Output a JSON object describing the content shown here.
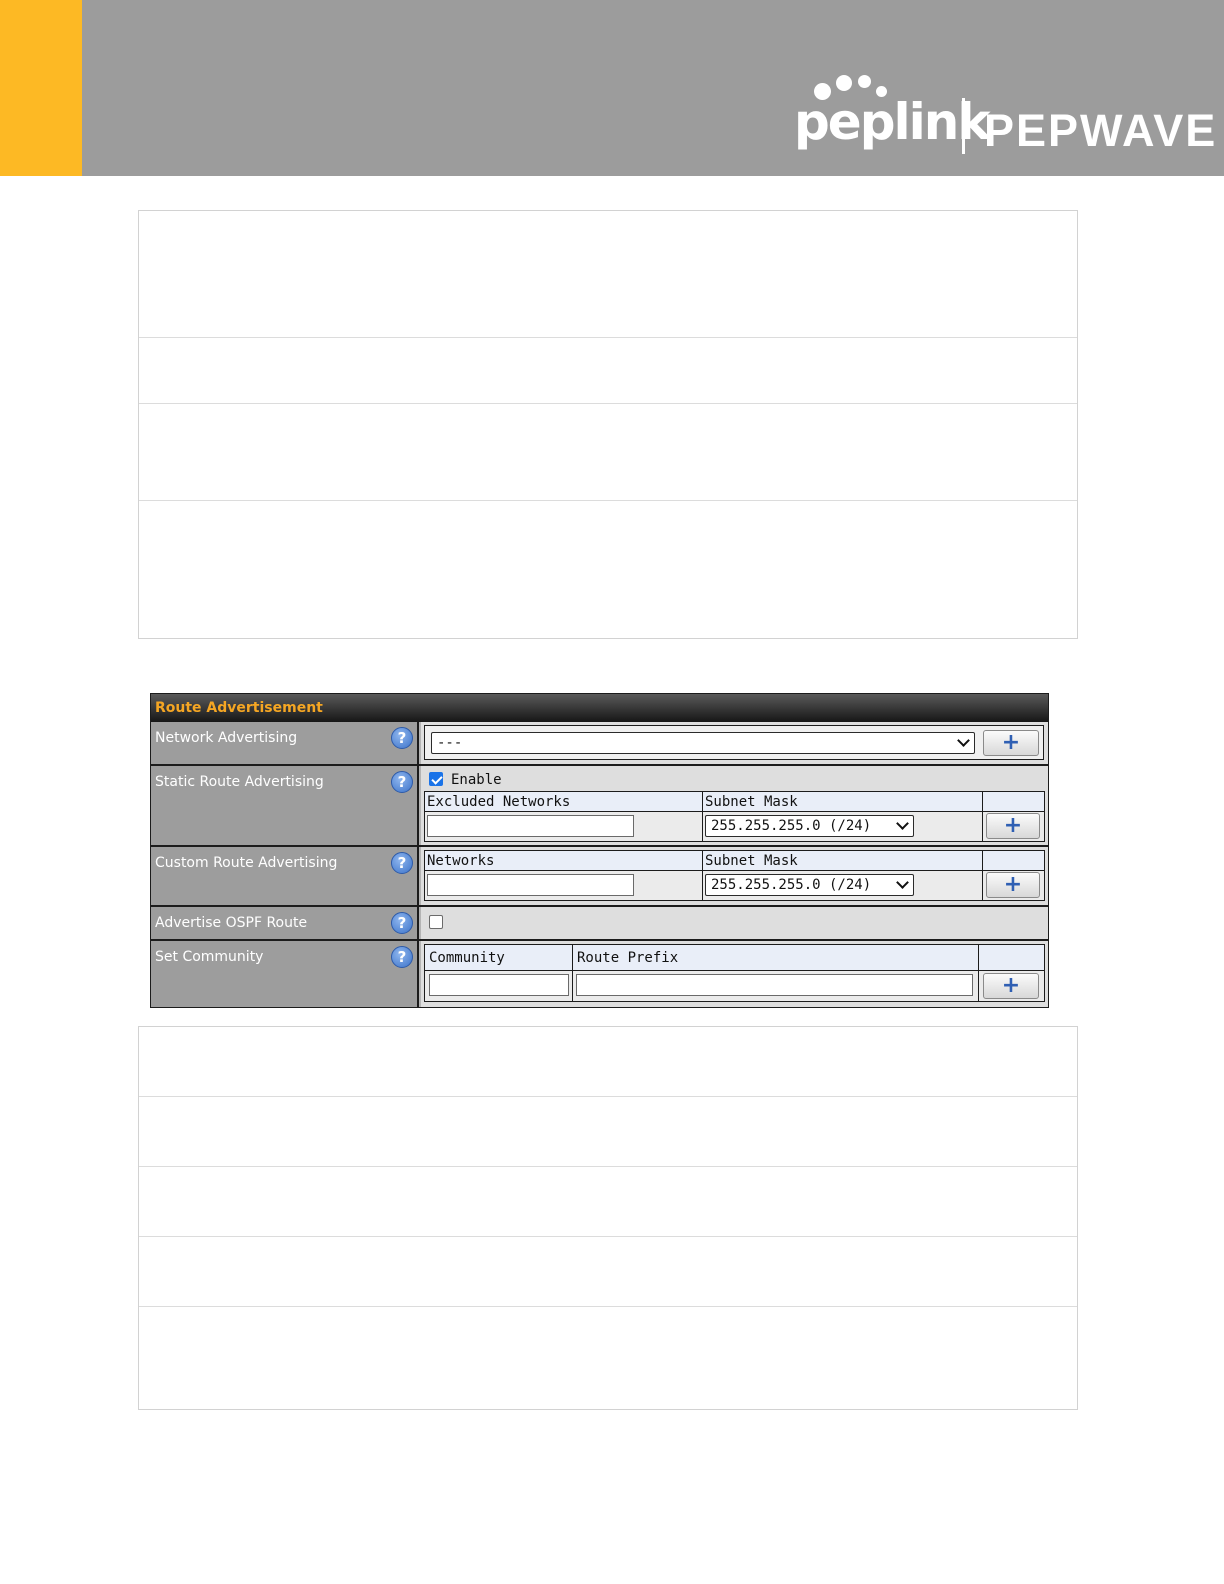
{
  "header": {
    "brand_primary": "peplink",
    "brand_secondary": "PEPWAVE",
    "banner_color": "#9c9c9c",
    "accent_color": "#fdb924"
  },
  "panel": {
    "title": "Route Advertisement",
    "title_color": "#f5a623",
    "rows": {
      "network_advertising": {
        "label": "Network Advertising",
        "selected": "---",
        "add_button": "+"
      },
      "static_route_advertising": {
        "label": "Static Route Advertising",
        "enable_label": "Enable",
        "enabled": true,
        "columns": [
          "Excluded Networks",
          "Subnet Mask"
        ],
        "network_value": "",
        "subnet_mask": "255.255.255.0 (/24)",
        "add_button": "+"
      },
      "custom_route_advertising": {
        "label": "Custom Route Advertising",
        "columns": [
          "Networks",
          "Subnet Mask"
        ],
        "network_value": "",
        "subnet_mask": "255.255.255.0 (/24)",
        "add_button": "+"
      },
      "advertise_ospf_route": {
        "label": "Advertise OSPF Route",
        "checked": false
      },
      "set_community": {
        "label": "Set Community",
        "columns": [
          "Community",
          "Route Prefix"
        ],
        "community_value": "",
        "route_prefix_value": "",
        "add_button": "+"
      }
    },
    "help_icon": "?"
  }
}
